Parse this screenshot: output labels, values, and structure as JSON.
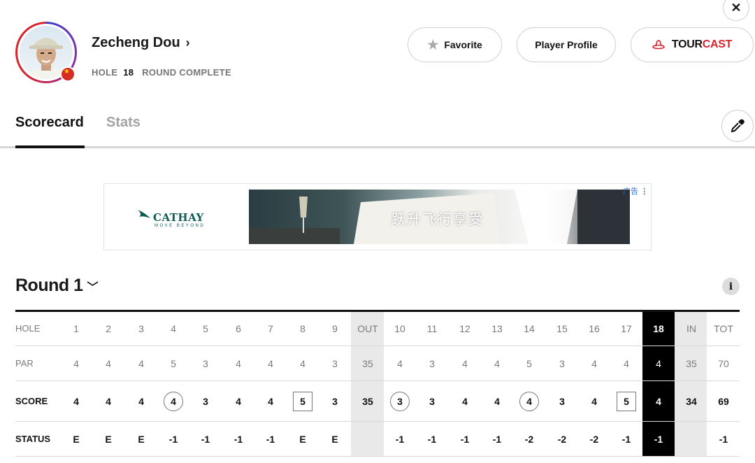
{
  "player": {
    "name": "Zecheng Dou",
    "hole_label": "HOLE",
    "hole_number": "18",
    "round_status": "ROUND COMPLETE"
  },
  "header_buttons": {
    "favorite": "Favorite",
    "player_profile": "Player Profile",
    "tourcast_tour": "TOUR",
    "tourcast_cast": "CAST"
  },
  "tabs": [
    {
      "label": "Scorecard",
      "active": true
    },
    {
      "label": "Stats",
      "active": false
    }
  ],
  "ad": {
    "brand": "CATHAY",
    "tagline": "MOVE BEYOND",
    "headline": "跃升飞行享受",
    "label": "广告"
  },
  "round": {
    "label": "Round 1"
  },
  "scorecard": {
    "row_labels": {
      "hole": "HOLE",
      "par": "PAR",
      "score": "SCORE",
      "status": "STATUS"
    },
    "columns": [
      {
        "hole": "1",
        "par": "4",
        "score": "4",
        "status": "E"
      },
      {
        "hole": "2",
        "par": "4",
        "score": "4",
        "status": "E"
      },
      {
        "hole": "3",
        "par": "4",
        "score": "4",
        "status": "E"
      },
      {
        "hole": "4",
        "par": "5",
        "score": "4",
        "status": "-1",
        "mark": "circle"
      },
      {
        "hole": "5",
        "par": "3",
        "score": "3",
        "status": "-1"
      },
      {
        "hole": "6",
        "par": "4",
        "score": "4",
        "status": "-1"
      },
      {
        "hole": "7",
        "par": "4",
        "score": "4",
        "status": "-1"
      },
      {
        "hole": "8",
        "par": "4",
        "score": "5",
        "status": "E",
        "mark": "square"
      },
      {
        "hole": "9",
        "par": "3",
        "score": "3",
        "status": "E"
      },
      {
        "hole": "OUT",
        "par": "35",
        "score": "35",
        "status": ""
      },
      {
        "hole": "10",
        "par": "4",
        "score": "3",
        "status": "-1",
        "mark": "circle"
      },
      {
        "hole": "11",
        "par": "3",
        "score": "3",
        "status": "-1"
      },
      {
        "hole": "12",
        "par": "4",
        "score": "4",
        "status": "-1"
      },
      {
        "hole": "13",
        "par": "4",
        "score": "4",
        "status": "-1"
      },
      {
        "hole": "14",
        "par": "5",
        "score": "4",
        "status": "-2",
        "mark": "circle"
      },
      {
        "hole": "15",
        "par": "3",
        "score": "3",
        "status": "-2"
      },
      {
        "hole": "16",
        "par": "4",
        "score": "4",
        "status": "-2"
      },
      {
        "hole": "17",
        "par": "4",
        "score": "5",
        "status": "-1",
        "mark": "square"
      },
      {
        "hole": "18",
        "par": "4",
        "score": "4",
        "status": "-1",
        "current": true
      },
      {
        "hole": "IN",
        "par": "35",
        "score": "34",
        "status": ""
      },
      {
        "hole": "TOT",
        "par": "70",
        "score": "69",
        "status": "-1"
      }
    ]
  },
  "colors": {
    "accent_red": "#d8242f",
    "highlight_black": "#000000",
    "subtotal_gray": "#e9e9e9"
  }
}
